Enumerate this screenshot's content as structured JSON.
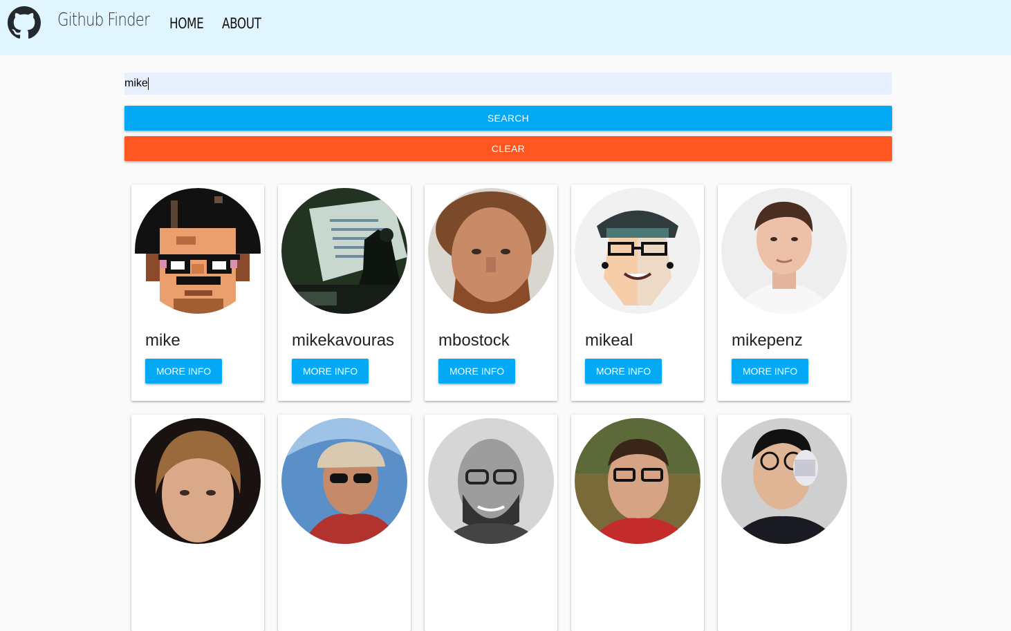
{
  "navbar": {
    "brand": "Github Finder",
    "logo_icon": "github-octocat-icon",
    "links": [
      "HOME",
      "ABOUT"
    ],
    "background": "#e1f5fe"
  },
  "search": {
    "value": "mike",
    "search_label": "SEARCH",
    "clear_label": "CLEAR"
  },
  "users": [
    {
      "login": "mike",
      "button": "MORE INFO",
      "avatar": "pixel-art-avatar"
    },
    {
      "login": "mikekavouras",
      "button": "MORE INFO",
      "avatar": "presentation-photo-avatar"
    },
    {
      "login": "mbostock",
      "button": "MORE INFO",
      "avatar": "bearded-man-photo-avatar"
    },
    {
      "login": "mikeal",
      "button": "MORE INFO",
      "avatar": "cartoon-man-avatar"
    },
    {
      "login": "mikepenz",
      "button": "MORE INFO",
      "avatar": "young-man-photo-avatar"
    },
    {
      "avatar": "man-portrait-photo-avatar"
    },
    {
      "avatar": "man-sunglasses-photo-avatar"
    },
    {
      "avatar": "bald-man-bw-photo-avatar"
    },
    {
      "avatar": "man-glasses-photo-avatar"
    },
    {
      "avatar": "man-drinking-photo-avatar"
    }
  ],
  "colors": {
    "primary": "#03a9f4",
    "danger": "#ff5722",
    "input_bg": "#e8f0fe"
  }
}
